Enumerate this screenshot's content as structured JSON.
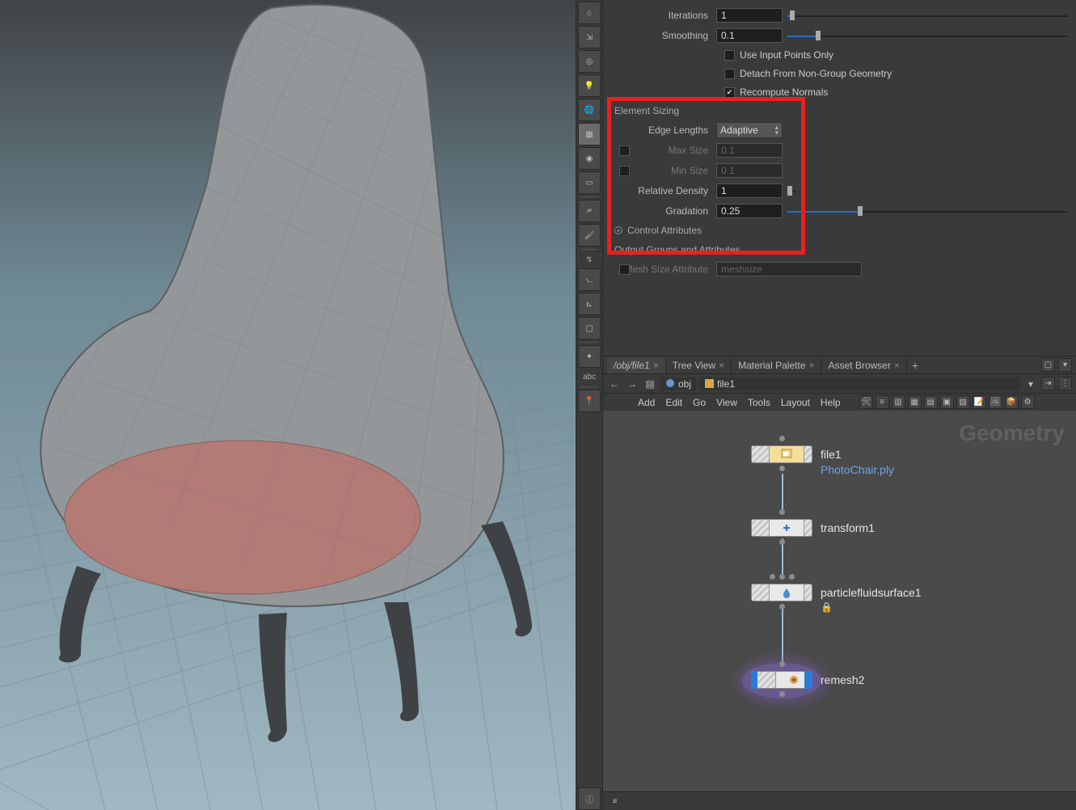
{
  "params": {
    "iterations": {
      "label": "Iterations",
      "value": "1"
    },
    "smoothing": {
      "label": "Smoothing",
      "value": "0.1"
    },
    "chk_use_input": "Use Input Points Only",
    "chk_detach": "Detach From Non-Group Geometry",
    "chk_recompute": "Recompute Normals",
    "element_sizing_hdr": "Element Sizing",
    "edge_lengths": {
      "label": "Edge Lengths",
      "value": "Adaptive"
    },
    "max_size": {
      "label": "Max Size",
      "value": "0.1"
    },
    "min_size": {
      "label": "Min Size",
      "value": "0.1"
    },
    "relative_density": {
      "label": "Relative Density",
      "value": "1"
    },
    "gradation": {
      "label": "Gradation",
      "value": "0.25"
    },
    "control_attrs_hdr": "Control Attributes",
    "output_hdr": "Output Groups and Attributes",
    "mesh_size_attr": {
      "label": "Mesh Size Attribute",
      "value": "meshsize"
    }
  },
  "shelf": {
    "abc": "abc"
  },
  "tabs": {
    "active": "/obj/file1",
    "items": [
      "Tree View",
      "Material Palette",
      "Asset Browser"
    ]
  },
  "path": {
    "obj": "obj",
    "file1": "file1"
  },
  "menu": {
    "items": [
      "Add",
      "Edit",
      "Go",
      "View",
      "Tools",
      "Layout",
      "Help"
    ]
  },
  "graph": {
    "context_label": "Geometry",
    "nodes": {
      "file1": {
        "name": "file1",
        "sub": "PhotoChair.ply"
      },
      "transform1": {
        "name": "transform1"
      },
      "pfs1": {
        "name": "particlefluidsurface1"
      },
      "remesh2": {
        "name": "remesh2"
      }
    }
  }
}
